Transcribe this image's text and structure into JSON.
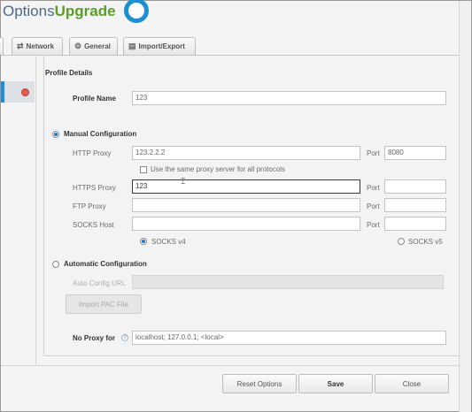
{
  "app": {
    "logo_part1": "Options",
    "logo_part2": "Upgrade"
  },
  "tabs": [
    {
      "label": "Network",
      "icon": "network-icon"
    },
    {
      "label": "General",
      "icon": "gear-icon"
    },
    {
      "label": "Import/Export",
      "icon": "import-export-icon"
    }
  ],
  "profile": {
    "section_title": "Profile Details",
    "name_label": "Profile Name",
    "name_value": "123"
  },
  "manual": {
    "label": "Manual Configuration",
    "selected": true,
    "http_label": "HTTP Proxy",
    "http_value": "123.2.2.2",
    "http_port_label": "Port",
    "http_port_value": "8080",
    "same_proxy_label": "Use the same proxy server for all protocols",
    "same_proxy_checked": false,
    "https_label": "HTTPS Proxy",
    "https_value": "123",
    "https_port_label": "Port",
    "https_port_value": "",
    "ftp_label": "FTP Proxy",
    "ftp_value": "",
    "ftp_port_label": "Port",
    "ftp_port_value": "",
    "socks_label": "SOCKS Host",
    "socks_value": "",
    "socks_port_label": "Port",
    "socks_port_value": "",
    "socks_v4_label": "SOCKS v4",
    "socks_v5_label": "SOCKS v5",
    "socks_version_selected": "v4"
  },
  "automatic": {
    "label": "Automatic Configuration",
    "selected": false,
    "auto_url_label": "Auto Config URL",
    "auto_url_value": "",
    "import_pac_label": "Import PAC File"
  },
  "no_proxy": {
    "label": "No Proxy for",
    "value": "localhost; 127.0.0.1; <local>"
  },
  "footer": {
    "reset_label": "Reset Options",
    "save_label": "Save",
    "close_label": "Close"
  },
  "colors": {
    "accent": "#1f8fd8",
    "logo_blue": "#4b6a8a",
    "logo_green": "#5a9e2a",
    "remove_dot": "#e35a4f"
  }
}
